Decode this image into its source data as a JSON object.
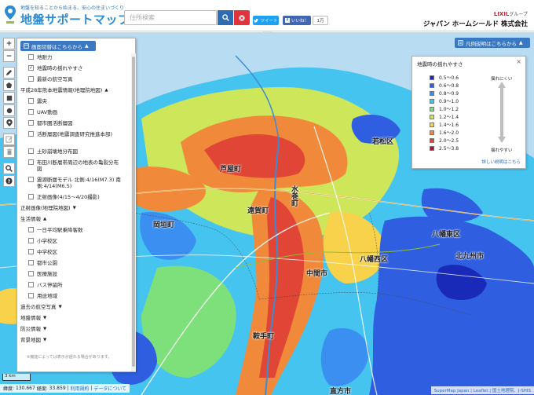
{
  "header": {
    "tagline": "地盤を知ることから始まる、安心の住まいづくり",
    "title": "地盤サポートマップ",
    "search_placeholder": "住所検索",
    "tweet_label": "ツイート",
    "fb_like_label": "いいね！",
    "fb_like_count": "1万",
    "group_brand": "LIXIL",
    "group_suffix": "グループ",
    "company_name": "ジャパン ホームシールド 株式会社"
  },
  "toolbar": {
    "zoom_in": "+",
    "zoom_out": "−"
  },
  "layer_panel": {
    "toggle_label": "画面切替はこちらから",
    "items": [
      {
        "label": "地耐力",
        "checked": false,
        "kind": "item"
      },
      {
        "label": "地震時の揺れやすさ",
        "checked": true,
        "kind": "item"
      },
      {
        "label": "最新の航空写真",
        "checked": false,
        "kind": "item"
      },
      {
        "label": "平成28年熊本地震情報(地理院地図)",
        "kind": "group",
        "open": true
      },
      {
        "label": "震央",
        "checked": false,
        "kind": "item"
      },
      {
        "label": "UAV動画",
        "checked": false,
        "kind": "item"
      },
      {
        "label": "都市圏活断層図",
        "checked": false,
        "kind": "item"
      },
      {
        "label": "活断層図(地震調査研究推進本部)",
        "checked": false,
        "kind": "item",
        "wrap": true
      },
      {
        "label": "土砂崩壊地分布図",
        "checked": false,
        "kind": "item"
      },
      {
        "label": "布田川断層帯周辺の地表の亀裂分布図",
        "checked": false,
        "kind": "item",
        "wrap": true
      },
      {
        "label": "震源断層モデル 北側:4/16(M7.3) 南側:4/14(M6.5)",
        "checked": false,
        "kind": "item",
        "wrap": true
      },
      {
        "label": "正射画像(4/15〜4/20撮影)",
        "checked": false,
        "kind": "item"
      },
      {
        "label": "正射画像(地理院地図)",
        "kind": "group",
        "open": false
      },
      {
        "label": "生活情報",
        "kind": "group",
        "open": true
      },
      {
        "label": "一日平均駅乗降客数",
        "checked": false,
        "kind": "item"
      },
      {
        "label": "小学校区",
        "checked": false,
        "kind": "item"
      },
      {
        "label": "中学校区",
        "checked": false,
        "kind": "item"
      },
      {
        "label": "都市公園",
        "checked": false,
        "kind": "item"
      },
      {
        "label": "医療施設",
        "checked": false,
        "kind": "item"
      },
      {
        "label": "バス停留所",
        "checked": false,
        "kind": "item"
      },
      {
        "label": "用途地域",
        "checked": false,
        "kind": "item"
      },
      {
        "label": "過去の航空写真",
        "kind": "group",
        "open": false
      },
      {
        "label": "地盤情報",
        "kind": "group",
        "open": false
      },
      {
        "label": "防災情報",
        "kind": "group",
        "open": false
      },
      {
        "label": "背景地図",
        "kind": "group",
        "open": false
      }
    ],
    "note": "※機能によっては表示が遅れる場合があります。"
  },
  "legend": {
    "toggle_label": "凡例説明はこちらから",
    "title": "地震時の揺れやすさ",
    "close": "×",
    "easy_label": "揺れにくい",
    "hard_label": "揺れやすい",
    "detail_link": "詳しい説明はこちら",
    "rows": [
      {
        "label": "0.5〜0.6",
        "color": "#1a2ab8"
      },
      {
        "label": "0.6〜0.8",
        "color": "#2f5fe0"
      },
      {
        "label": "0.8〜0.9",
        "color": "#3b8ff0"
      },
      {
        "label": "0.9〜1.0",
        "color": "#46c4f0"
      },
      {
        "label": "1.0〜1.2",
        "color": "#7ee07a"
      },
      {
        "label": "1.2〜1.4",
        "color": "#cde65a"
      },
      {
        "label": "1.4〜1.6",
        "color": "#f7d24a"
      },
      {
        "label": "1.6〜2.0",
        "color": "#f08a3a"
      },
      {
        "label": "2.0〜2.5",
        "color": "#e04535"
      },
      {
        "label": "2.5〜3.8",
        "color": "#a6123a"
      }
    ]
  },
  "map_labels": {
    "ashiya": "芦屋町",
    "ongacho": "遠賀町",
    "mizumaki": "水巻町",
    "okagaki": "岡垣町",
    "nakama": "中間市",
    "yahatanishi": "八幡西区",
    "yahatahigashi": "八幡東区",
    "kitakyushu": "北九州市",
    "wakamatsu": "若松区",
    "kurate": "鞍手町",
    "nogata": "直方市"
  },
  "scale_label": "3 km",
  "coords": {
    "lat_label": "緯度",
    "lat_value": "130.667",
    "lon_label": "経度",
    "lon_value": "33.859",
    "terms_link": "利用規約",
    "data_link": "データについて"
  },
  "attribution": "SuperMap Japan | Leaflet | 国土地理院、J-SHIS",
  "colors": {
    "header_blue": "#2a8ad4",
    "panel_blue": "#3a78c3",
    "search_blue": "#2e6db4",
    "clear_red": "#e0333b"
  }
}
